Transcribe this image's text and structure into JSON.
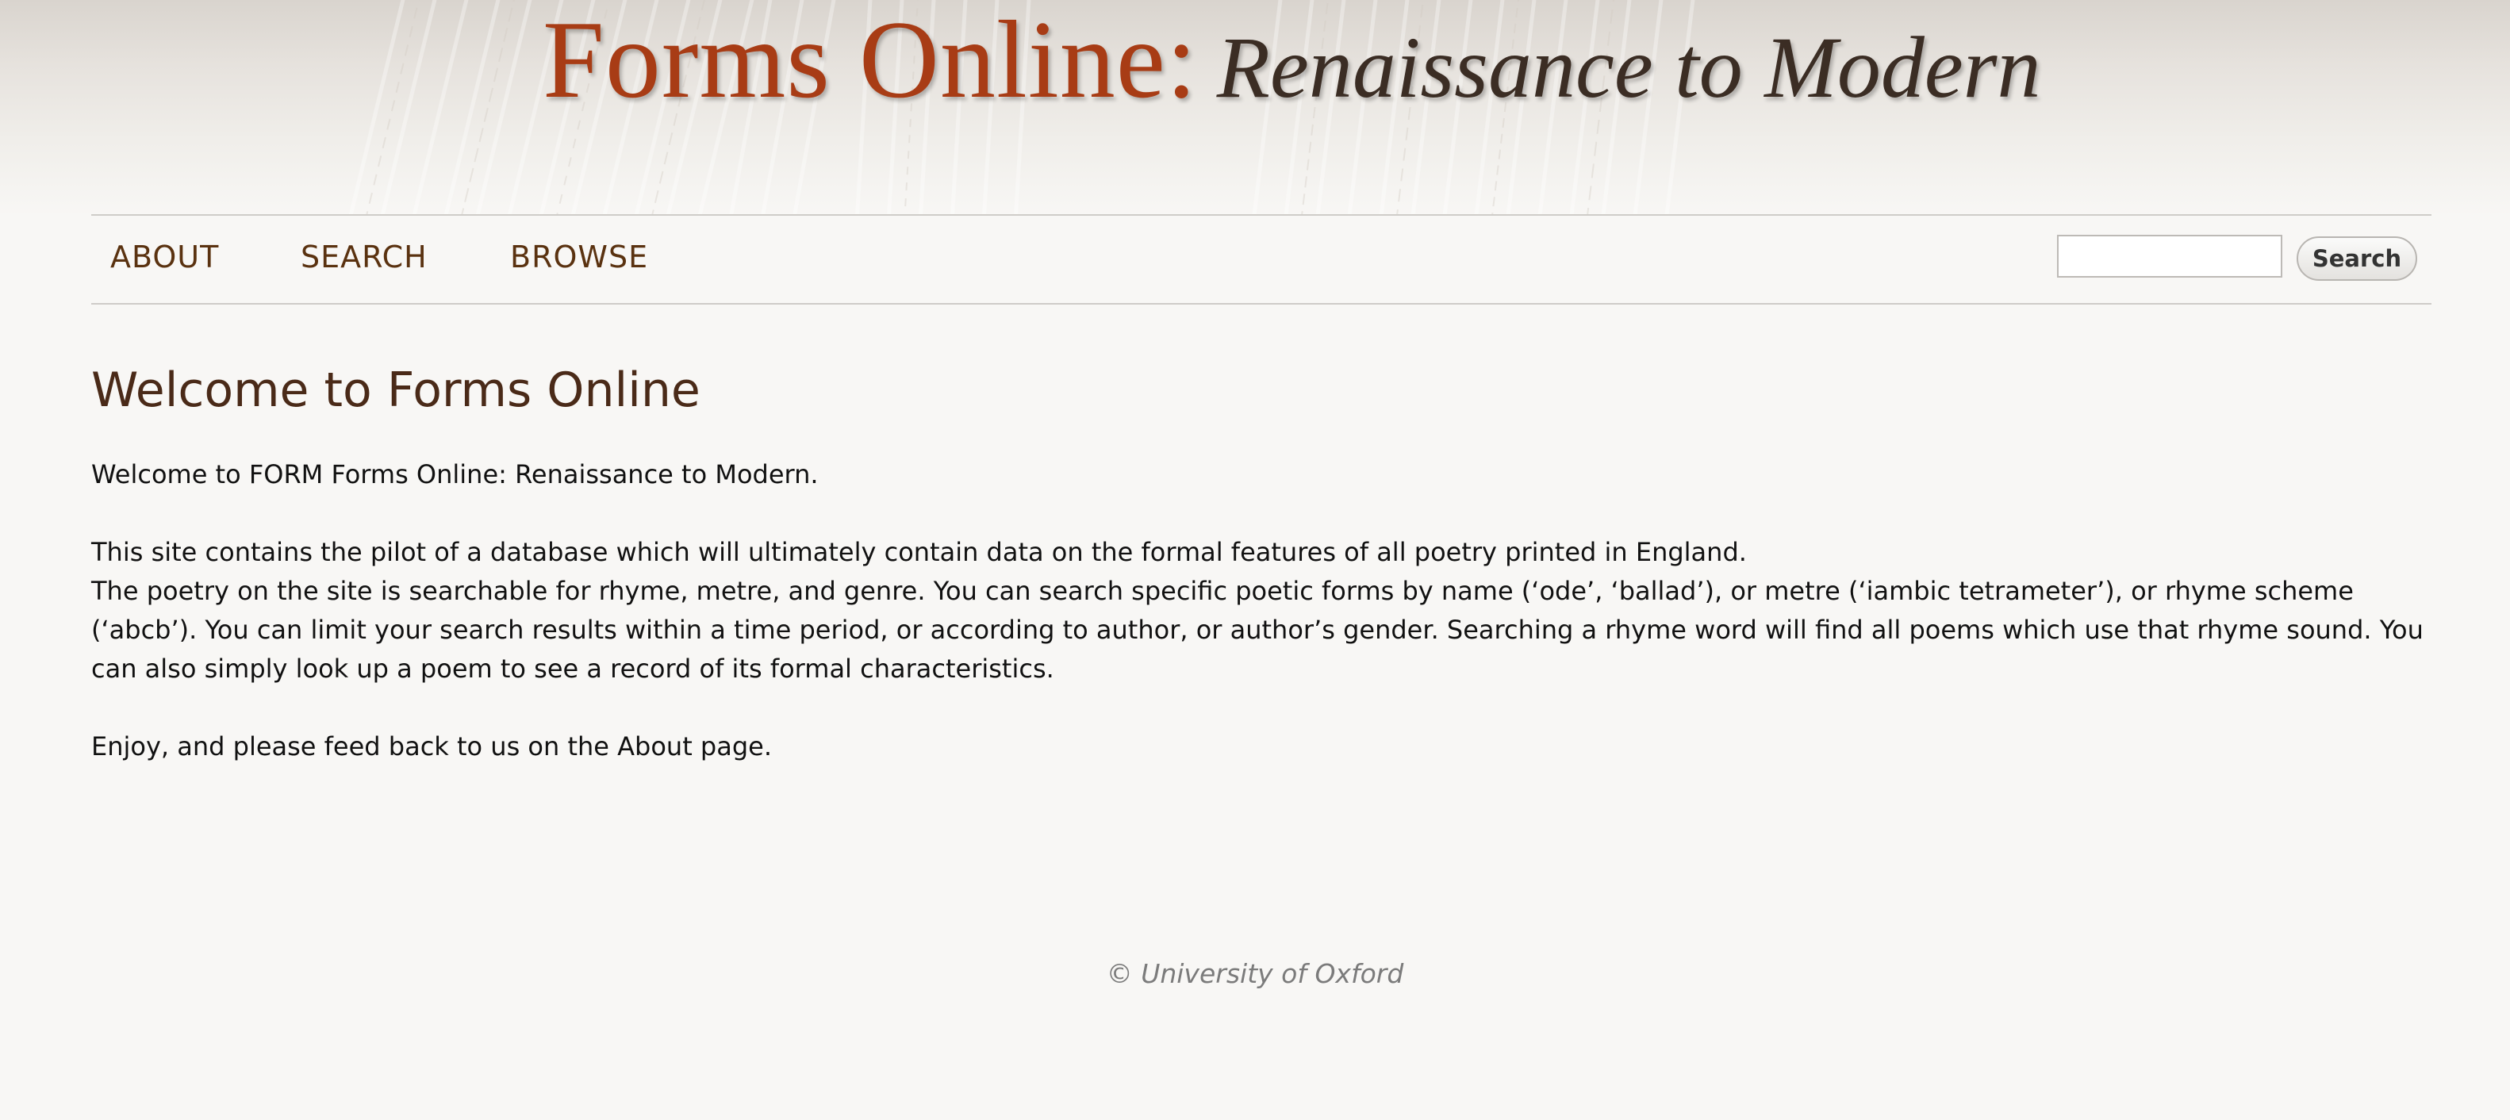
{
  "header": {
    "title_main": "Forms Online:",
    "title_sub": "Renaissance to Modern"
  },
  "nav": {
    "items": [
      {
        "label": "ABOUT"
      },
      {
        "label": "SEARCH"
      },
      {
        "label": "BROWSE"
      }
    ],
    "search": {
      "value": "",
      "placeholder": "",
      "button_label": "Search"
    }
  },
  "main": {
    "title": "Welcome to Forms Online",
    "paragraphs": [
      "Welcome to FORM Forms Online: Renaissance to Modern.",
      "This site contains the pilot of a database which will ultimately contain data on the formal features of all poetry printed in England.",
      "The poetry on the site is searchable for rhyme, metre, and genre. You can search specific poetic forms by name (‘ode’, ‘ballad’), or metre (‘iambic tetrameter’), or rhyme scheme (‘abcb’). You can limit your search results within a time period, or according to author, or author’s gender. Searching a rhyme word will find all poems which use that rhyme sound. You can also simply look up a poem to see a record of its formal characteristics.",
      "Enjoy, and please feed back to us on the About page."
    ]
  },
  "footer": {
    "copyright": "© University of Oxford"
  },
  "colors": {
    "accent": "#a83c15",
    "nav_text": "#5a3210",
    "heading": "#4a2a18",
    "background": "#f8f7f5"
  }
}
